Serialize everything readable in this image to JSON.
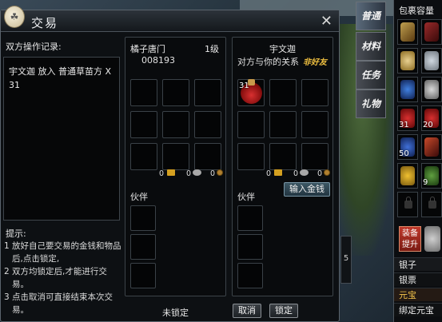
{
  "dialog": {
    "title": "交易",
    "close_label": "✕",
    "record_title": "双方操作记录:",
    "record_text": "宇文迦 放入 普通草苗方 X 31",
    "hint_title": "提示:",
    "hints": [
      "1 放好自己要交易的金钱和物品后,点击锁定,",
      "2 双方均锁定后,才能进行交易。",
      "3 点击取消可直接结束本次交易。"
    ],
    "status": "未锁定",
    "cancel_label": "取消",
    "lock_label": "锁定"
  },
  "left_panel": {
    "name": "橘子唐门",
    "level": "1级",
    "id": "008193",
    "money": {
      "gold": "0",
      "silver": "0",
      "copper": "0"
    },
    "partner_label": "伙伴"
  },
  "right_panel": {
    "name": "宇文迦",
    "relation_label": "对方与你的关系",
    "relation_value": "非好友",
    "item_count": "31",
    "money": {
      "gold": "0",
      "silver": "0",
      "copper": "0"
    },
    "add_money_label": "输入金钱",
    "partner_label": "伙伴"
  },
  "tabs": [
    "普通",
    "材料",
    "任务",
    "礼物"
  ],
  "inventory": {
    "title": "包裹容量",
    "counts": [
      "31",
      "20",
      "50",
      "9"
    ],
    "equip_label": "装备提升",
    "currencies": [
      "银子",
      "银票",
      "元宝",
      "绑定元宝"
    ]
  },
  "side_frame": {
    "value": "5"
  }
}
